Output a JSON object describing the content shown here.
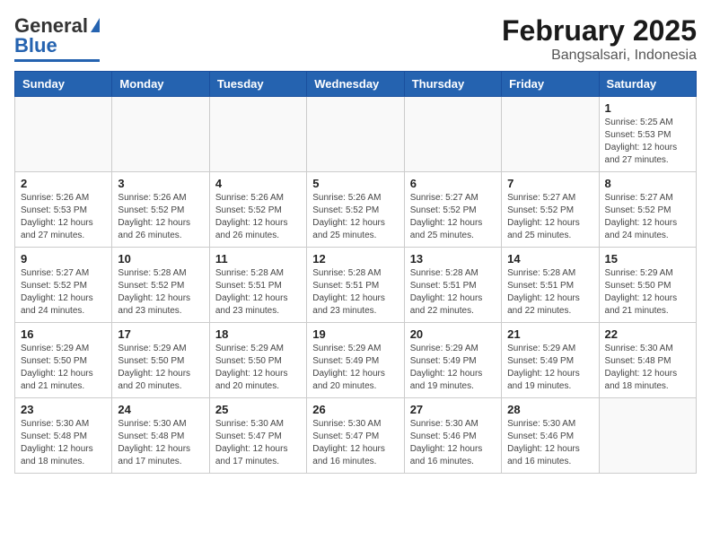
{
  "header": {
    "logo_line1": "General",
    "logo_line2": "Blue",
    "title": "February 2025",
    "subtitle": "Bangsalsari, Indonesia"
  },
  "calendar": {
    "days_of_week": [
      "Sunday",
      "Monday",
      "Tuesday",
      "Wednesday",
      "Thursday",
      "Friday",
      "Saturday"
    ],
    "weeks": [
      [
        {
          "day": "",
          "info": ""
        },
        {
          "day": "",
          "info": ""
        },
        {
          "day": "",
          "info": ""
        },
        {
          "day": "",
          "info": ""
        },
        {
          "day": "",
          "info": ""
        },
        {
          "day": "",
          "info": ""
        },
        {
          "day": "1",
          "info": "Sunrise: 5:25 AM\nSunset: 5:53 PM\nDaylight: 12 hours\nand 27 minutes."
        }
      ],
      [
        {
          "day": "2",
          "info": "Sunrise: 5:26 AM\nSunset: 5:53 PM\nDaylight: 12 hours\nand 27 minutes."
        },
        {
          "day": "3",
          "info": "Sunrise: 5:26 AM\nSunset: 5:52 PM\nDaylight: 12 hours\nand 26 minutes."
        },
        {
          "day": "4",
          "info": "Sunrise: 5:26 AM\nSunset: 5:52 PM\nDaylight: 12 hours\nand 26 minutes."
        },
        {
          "day": "5",
          "info": "Sunrise: 5:26 AM\nSunset: 5:52 PM\nDaylight: 12 hours\nand 25 minutes."
        },
        {
          "day": "6",
          "info": "Sunrise: 5:27 AM\nSunset: 5:52 PM\nDaylight: 12 hours\nand 25 minutes."
        },
        {
          "day": "7",
          "info": "Sunrise: 5:27 AM\nSunset: 5:52 PM\nDaylight: 12 hours\nand 25 minutes."
        },
        {
          "day": "8",
          "info": "Sunrise: 5:27 AM\nSunset: 5:52 PM\nDaylight: 12 hours\nand 24 minutes."
        }
      ],
      [
        {
          "day": "9",
          "info": "Sunrise: 5:27 AM\nSunset: 5:52 PM\nDaylight: 12 hours\nand 24 minutes."
        },
        {
          "day": "10",
          "info": "Sunrise: 5:28 AM\nSunset: 5:52 PM\nDaylight: 12 hours\nand 23 minutes."
        },
        {
          "day": "11",
          "info": "Sunrise: 5:28 AM\nSunset: 5:51 PM\nDaylight: 12 hours\nand 23 minutes."
        },
        {
          "day": "12",
          "info": "Sunrise: 5:28 AM\nSunset: 5:51 PM\nDaylight: 12 hours\nand 23 minutes."
        },
        {
          "day": "13",
          "info": "Sunrise: 5:28 AM\nSunset: 5:51 PM\nDaylight: 12 hours\nand 22 minutes."
        },
        {
          "day": "14",
          "info": "Sunrise: 5:28 AM\nSunset: 5:51 PM\nDaylight: 12 hours\nand 22 minutes."
        },
        {
          "day": "15",
          "info": "Sunrise: 5:29 AM\nSunset: 5:50 PM\nDaylight: 12 hours\nand 21 minutes."
        }
      ],
      [
        {
          "day": "16",
          "info": "Sunrise: 5:29 AM\nSunset: 5:50 PM\nDaylight: 12 hours\nand 21 minutes."
        },
        {
          "day": "17",
          "info": "Sunrise: 5:29 AM\nSunset: 5:50 PM\nDaylight: 12 hours\nand 20 minutes."
        },
        {
          "day": "18",
          "info": "Sunrise: 5:29 AM\nSunset: 5:50 PM\nDaylight: 12 hours\nand 20 minutes."
        },
        {
          "day": "19",
          "info": "Sunrise: 5:29 AM\nSunset: 5:49 PM\nDaylight: 12 hours\nand 20 minutes."
        },
        {
          "day": "20",
          "info": "Sunrise: 5:29 AM\nSunset: 5:49 PM\nDaylight: 12 hours\nand 19 minutes."
        },
        {
          "day": "21",
          "info": "Sunrise: 5:29 AM\nSunset: 5:49 PM\nDaylight: 12 hours\nand 19 minutes."
        },
        {
          "day": "22",
          "info": "Sunrise: 5:30 AM\nSunset: 5:48 PM\nDaylight: 12 hours\nand 18 minutes."
        }
      ],
      [
        {
          "day": "23",
          "info": "Sunrise: 5:30 AM\nSunset: 5:48 PM\nDaylight: 12 hours\nand 18 minutes."
        },
        {
          "day": "24",
          "info": "Sunrise: 5:30 AM\nSunset: 5:48 PM\nDaylight: 12 hours\nand 17 minutes."
        },
        {
          "day": "25",
          "info": "Sunrise: 5:30 AM\nSunset: 5:47 PM\nDaylight: 12 hours\nand 17 minutes."
        },
        {
          "day": "26",
          "info": "Sunrise: 5:30 AM\nSunset: 5:47 PM\nDaylight: 12 hours\nand 16 minutes."
        },
        {
          "day": "27",
          "info": "Sunrise: 5:30 AM\nSunset: 5:46 PM\nDaylight: 12 hours\nand 16 minutes."
        },
        {
          "day": "28",
          "info": "Sunrise: 5:30 AM\nSunset: 5:46 PM\nDaylight: 12 hours\nand 16 minutes."
        },
        {
          "day": "",
          "info": ""
        }
      ]
    ]
  }
}
